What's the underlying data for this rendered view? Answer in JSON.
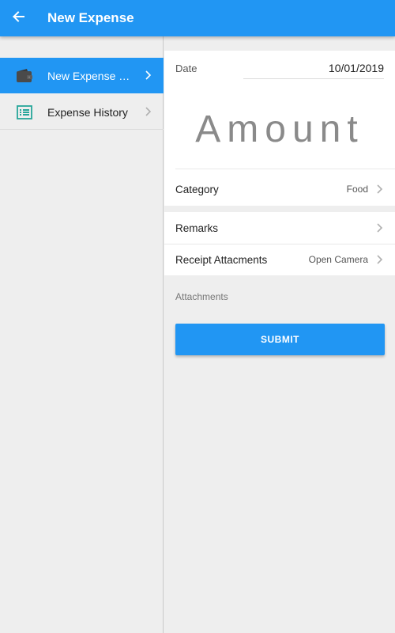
{
  "appbar": {
    "title": "New Expense",
    "back_icon": "arrow-back-icon",
    "color": "#2196f3"
  },
  "sidebar": {
    "items": [
      {
        "label": "New Expense Claim",
        "icon": "wallet-icon",
        "active": true
      },
      {
        "label": "Expense History",
        "icon": "list-icon",
        "active": false
      }
    ]
  },
  "form": {
    "date_label": "Date",
    "date_value": "10/01/2019",
    "amount_placeholder": "Amount",
    "category_label": "Category",
    "category_value": "Food",
    "remarks_label": "Remarks",
    "receipt_label": "Receipt Attacments",
    "receipt_value": "Open Camera",
    "attachments_label": "Attachments",
    "submit_label": "SUBMIT"
  },
  "colors": {
    "accent": "#2196f3",
    "icon_teal": "#26a69a",
    "wallet_dark": "#4a4a4a"
  }
}
